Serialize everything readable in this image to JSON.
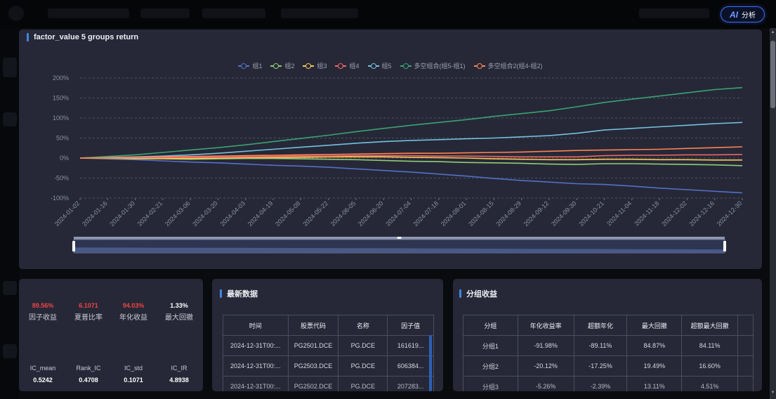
{
  "header": {
    "ai_button": {
      "mark": "AI",
      "label": "分析"
    }
  },
  "chart_panel": {
    "title": "factor_value 5 groups return",
    "chart_data": {
      "type": "line",
      "title": "factor_value 5 groups return",
      "yticks": [
        "200%",
        "150%",
        "100%",
        "50%",
        "0%",
        "-50%",
        "-100%"
      ],
      "ylim": [
        -100,
        200
      ],
      "grid": true,
      "legend_position": "top-center",
      "x": [
        "2024-01-02",
        "2024-01-16",
        "2024-01-30",
        "2024-02-21",
        "2024-03-06",
        "2024-03-20",
        "2024-04-03",
        "2024-04-19",
        "2024-05-08",
        "2024-05-22",
        "2024-06-05",
        "2024-06-20",
        "2024-07-04",
        "2024-07-18",
        "2024-08-01",
        "2024-08-15",
        "2024-08-29",
        "2024-09-12",
        "2024-09-30",
        "2024-10-21",
        "2024-11-04",
        "2024-11-18",
        "2024-12-02",
        "2024-12-16",
        "2024-12-30"
      ],
      "series": [
        {
          "name": "组1",
          "color": "#5470c6",
          "values": [
            0,
            -2,
            -4,
            -7,
            -10,
            -12,
            -15,
            -18,
            -20,
            -23,
            -27,
            -31,
            -35,
            -40,
            -45,
            -51,
            -56,
            -60,
            -64,
            -66,
            -70,
            -75,
            -79,
            -83,
            -87
          ]
        },
        {
          "name": "组2",
          "color": "#91cc75",
          "values": [
            0,
            -1,
            -2,
            -2,
            -3,
            -2,
            -1,
            -1,
            -2,
            -3,
            -4,
            -6,
            -8,
            -9,
            -11,
            -12,
            -13,
            -15,
            -16,
            -14,
            -14,
            -15,
            -16,
            -17,
            -19
          ]
        },
        {
          "name": "组3",
          "color": "#fac858",
          "values": [
            0,
            0,
            -1,
            -1,
            -1,
            0,
            1,
            1,
            2,
            3,
            3,
            3,
            2,
            1,
            0,
            -2,
            -3,
            -4,
            -4,
            -3,
            -3,
            -4,
            -4,
            -5,
            -5
          ]
        },
        {
          "name": "组4",
          "color": "#ee6666",
          "values": [
            0,
            0,
            1,
            1,
            2,
            2,
            3,
            4,
            5,
            5,
            6,
            6,
            6,
            5,
            5,
            4,
            3,
            3,
            3,
            6,
            7,
            7,
            8,
            8,
            9
          ]
        },
        {
          "name": "组5",
          "color": "#73c0de",
          "values": [
            0,
            2,
            3,
            5,
            8,
            12,
            17,
            22,
            27,
            32,
            37,
            41,
            44,
            46,
            48,
            50,
            53,
            56,
            62,
            70,
            74,
            78,
            82,
            86,
            89
          ]
        },
        {
          "name": "多空组合(组5-组1)",
          "color": "#3ba272",
          "values": [
            0,
            4,
            8,
            14,
            20,
            26,
            33,
            41,
            49,
            57,
            66,
            74,
            82,
            89,
            96,
            104,
            111,
            118,
            128,
            139,
            147,
            155,
            163,
            171,
            176
          ]
        },
        {
          "name": "多空组合2(组4-组2)",
          "color": "#fc8452",
          "values": [
            0,
            1,
            2,
            3,
            4,
            5,
            6,
            7,
            8,
            9,
            10,
            11,
            12,
            12,
            13,
            14,
            15,
            17,
            19,
            20,
            21,
            22,
            24,
            26,
            28
          ]
        }
      ],
      "datazoom": {
        "start": 0,
        "end": 100
      }
    }
  },
  "stats_panel": {
    "top": [
      {
        "value": "89.56%",
        "label": "因子收益",
        "color": "#ef4444"
      },
      {
        "value": "6.1071",
        "label": "夏普比率",
        "color": "#ef4444"
      },
      {
        "value": "94.03%",
        "label": "年化收益",
        "color": "#ef4444"
      },
      {
        "value": "1.33%",
        "label": "最大回撤",
        "color": "#ffffff"
      }
    ],
    "bottom": [
      {
        "label": "IC_mean",
        "value": "0.5242"
      },
      {
        "label": "Rank_IC",
        "value": "0.4708"
      },
      {
        "label": "IC_std",
        "value": "0.1071"
      },
      {
        "label": "IC_IR",
        "value": "4.8938"
      }
    ]
  },
  "latest_panel": {
    "title": "最新数据",
    "headers": [
      "时间",
      "股票代码",
      "名称",
      "因子值"
    ],
    "rows": [
      [
        "2024-12-31T00:...",
        "PG2501.DCE",
        "PG.DCE",
        "161619..."
      ],
      [
        "2024-12-31T00:...",
        "PG2503.DCE",
        "PG.DCE",
        "606384..."
      ],
      [
        "2024-12-31T00:...",
        "PG2502.DCE",
        "PG.DCE",
        "207283..."
      ]
    ]
  },
  "group_panel": {
    "title": "分组收益",
    "headers": [
      "分组",
      "年化收益率",
      "超额年化",
      "最大回撤",
      "超额最大回撤"
    ],
    "rows": [
      [
        "分组1",
        "-91.98%",
        "-89.11%",
        "84.87%",
        "84.11%"
      ],
      [
        "分组2",
        "-20.12%",
        "-17.25%",
        "19.49%",
        "16.60%"
      ],
      [
        "分组3",
        "-5.26%",
        "-2.39%",
        "13.11%",
        "4.51%"
      ]
    ]
  }
}
